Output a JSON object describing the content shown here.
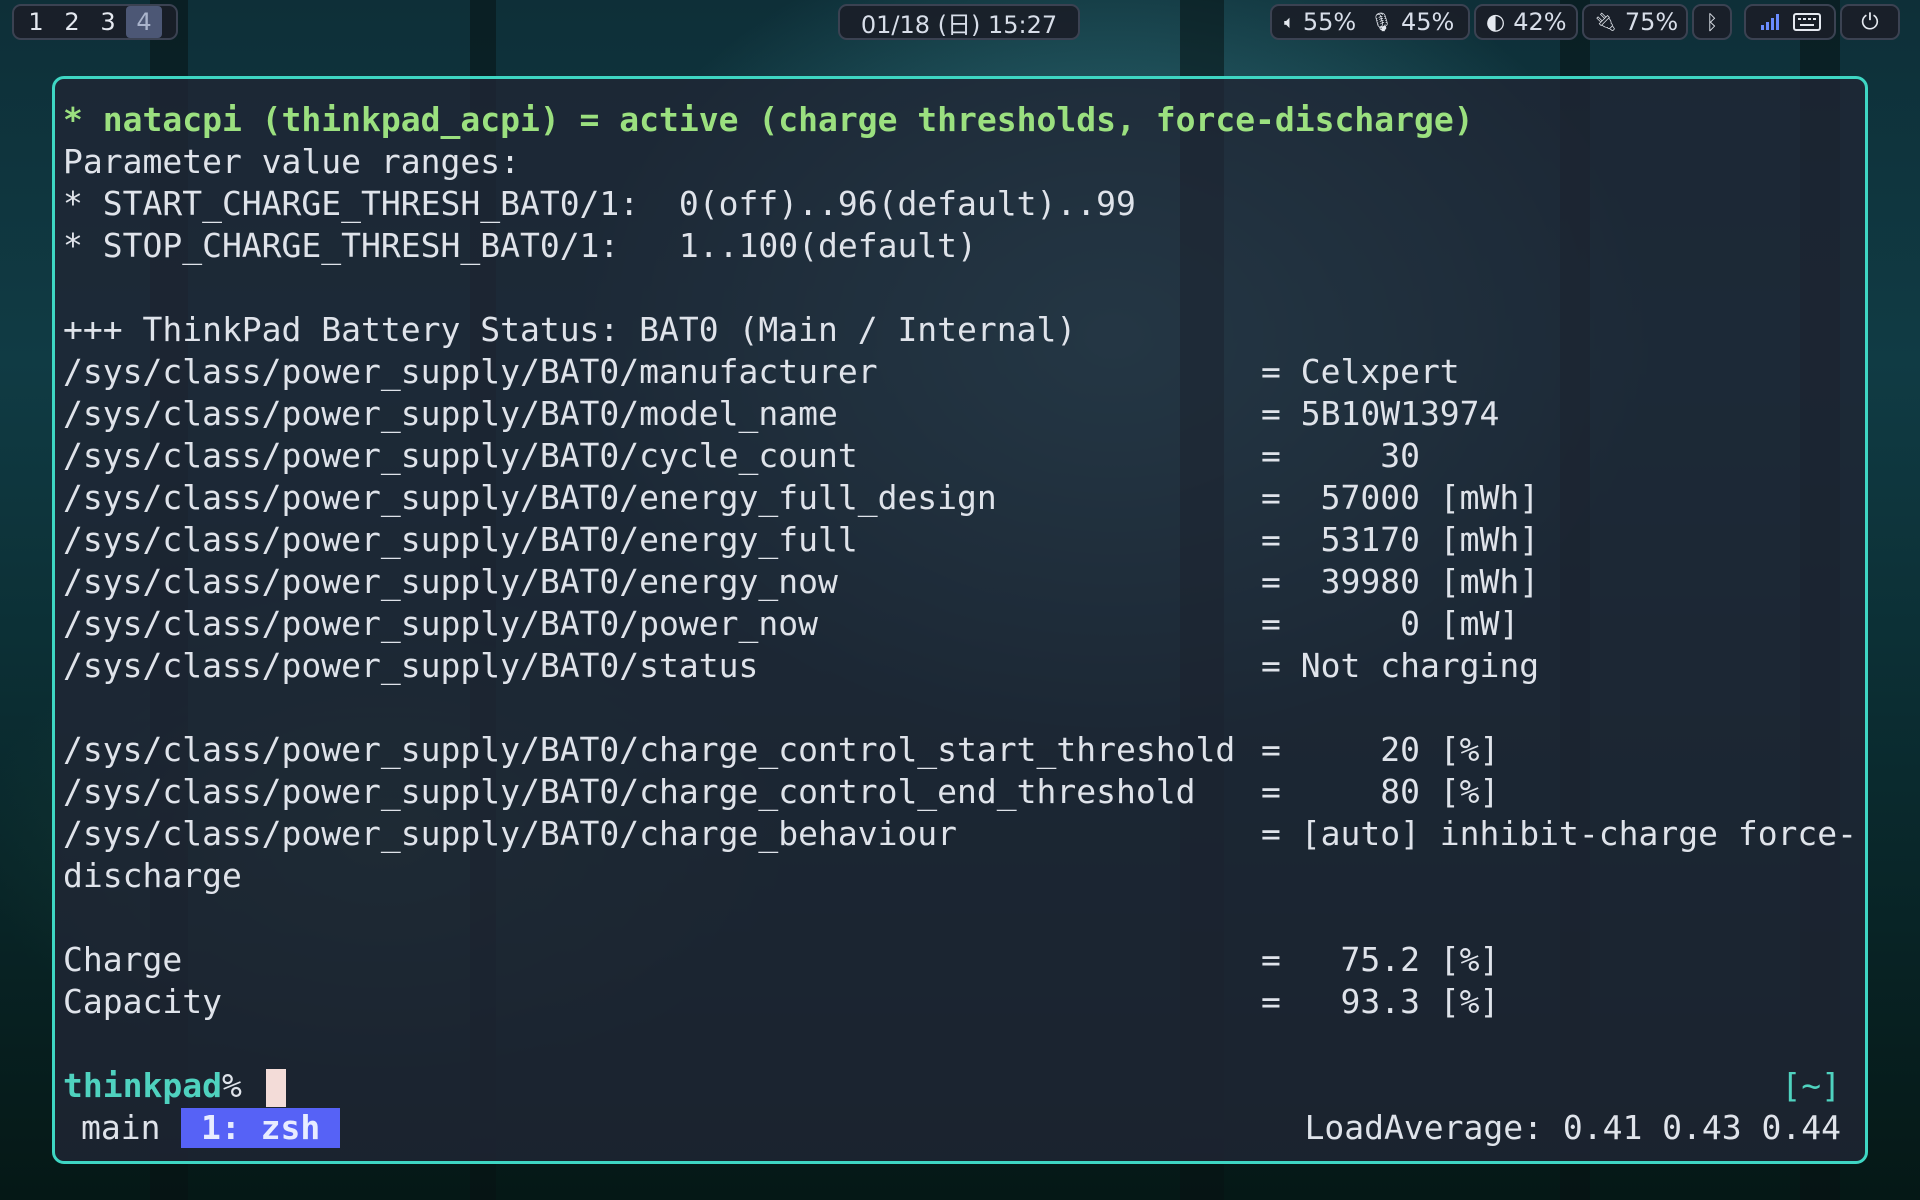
{
  "topbar": {
    "workspaces": [
      "1",
      "2",
      "3",
      "4"
    ],
    "active_workspace": "4",
    "clock": "01/18 (日) 15:27",
    "volume": "55%",
    "mic": "45%",
    "brightness": "42%",
    "battery": "75%"
  },
  "terminal": {
    "header": "* natacpi (thinkpad_acpi) = active (charge thresholds, force-discharge)",
    "ranges_title": "Parameter value ranges:",
    "range_start": "* START_CHARGE_THRESH_BAT0/1:  0(off)..96(default)..99",
    "range_stop": "* STOP_CHARGE_THRESH_BAT0/1:   1..100(default)",
    "status_title": "+++ ThinkPad Battery Status: BAT0 (Main / Internal)",
    "rows": [
      {
        "key": "/sys/class/power_supply/BAT0/manufacturer",
        "value": "= Celxpert"
      },
      {
        "key": "/sys/class/power_supply/BAT0/model_name",
        "value": "= 5B10W13974"
      },
      {
        "key": "/sys/class/power_supply/BAT0/cycle_count",
        "value": "=     30"
      },
      {
        "key": "/sys/class/power_supply/BAT0/energy_full_design",
        "value": "=  57000 [mWh]"
      },
      {
        "key": "/sys/class/power_supply/BAT0/energy_full",
        "value": "=  53170 [mWh]"
      },
      {
        "key": "/sys/class/power_supply/BAT0/energy_now",
        "value": "=  39980 [mWh]"
      },
      {
        "key": "/sys/class/power_supply/BAT0/power_now",
        "value": "=      0 [mW]"
      },
      {
        "key": "/sys/class/power_supply/BAT0/status",
        "value": "= Not charging"
      }
    ],
    "threshold_rows": [
      {
        "key": "/sys/class/power_supply/BAT0/charge_control_start_threshold",
        "value": "=     20 [%]"
      },
      {
        "key": "/sys/class/power_supply/BAT0/charge_control_end_threshold",
        "value": "=     80 [%]"
      },
      {
        "key": "/sys/class/power_supply/BAT0/charge_behaviour",
        "value": "= [auto] inhibit-charge force-"
      }
    ],
    "wrap_continuation": "discharge",
    "summary_rows": [
      {
        "key": "Charge",
        "value": "=   75.2 [%]"
      },
      {
        "key": "Capacity",
        "value": "=   93.3 [%]"
      }
    ],
    "prompt_host": "thinkpad",
    "prompt_symbol": "%",
    "cwd": "[~]"
  },
  "tmux": {
    "session": "main",
    "window": "1: zsh",
    "load_average": "LoadAverage: 0.41 0.43 0.44"
  },
  "colors": {
    "border": "#3ed6c3",
    "header_green": "#9be07f",
    "prompt_teal": "#4fd2bf",
    "tmux_active": "#5662f6"
  }
}
